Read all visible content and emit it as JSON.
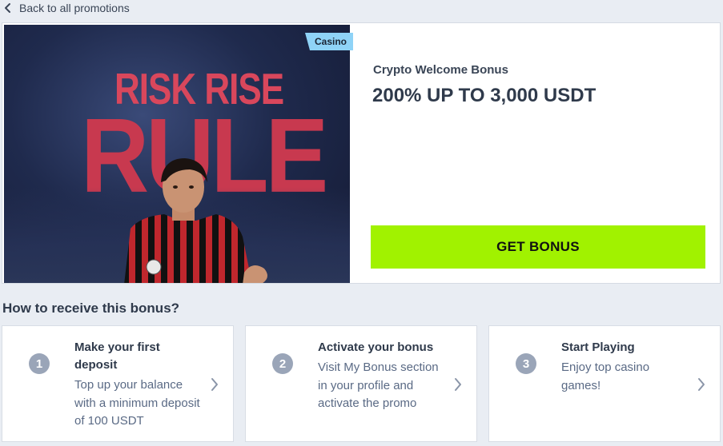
{
  "nav": {
    "back_label": "Back to all promotions"
  },
  "promo": {
    "category_tag": "Casino",
    "subtitle": "Crypto Welcome Bonus",
    "title": "200% UP TO 3,000 USDT",
    "cta_label": "GET BONUS",
    "banner": {
      "line1": "RISK RISE",
      "line2": "RULE"
    }
  },
  "how_to": {
    "heading": "How to receive this bonus?",
    "steps": [
      {
        "number": "1",
        "title": "Make your first deposit",
        "description": "Top up your balance with a minimum deposit of 100 USDT"
      },
      {
        "number": "2",
        "title": "Activate your bonus",
        "description": "Visit My Bonus section in your profile and activate the promo"
      },
      {
        "number": "3",
        "title": "Start Playing",
        "description": "Enjoy top casino games!"
      }
    ]
  },
  "colors": {
    "page_bg": "#e9edf3",
    "cta_bg": "#a1f200",
    "tag_bg": "#8fd3f7",
    "step_badge": "#9aa5b8",
    "banner_text": "#c8394f"
  },
  "icons": {
    "back": "chevron-left-icon",
    "step_arrow": "chevron-right-icon"
  }
}
